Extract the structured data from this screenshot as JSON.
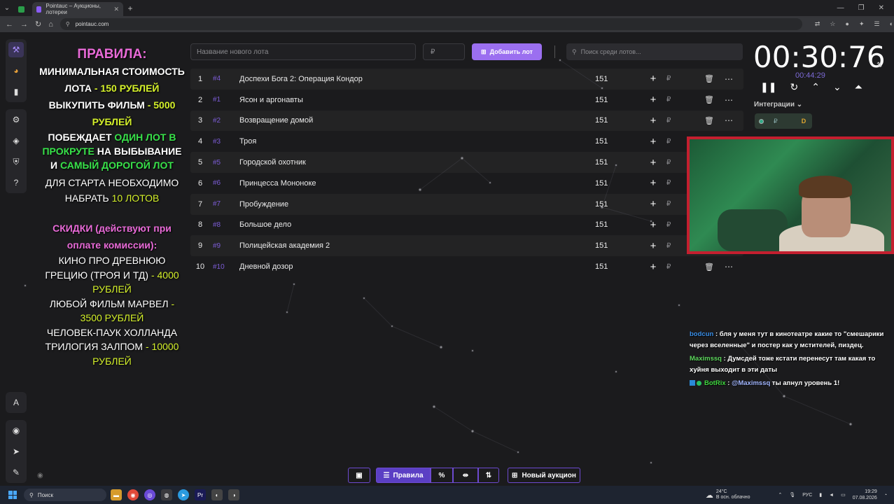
{
  "browser": {
    "tabs": [
      {
        "title": ""
      },
      {
        "title": "Pointauc – Аукционы, лотереи"
      }
    ],
    "url": "pointauc.com"
  },
  "rules": {
    "title": "ПРАВИЛА:",
    "min_price_label": "МИНИМАЛЬНАЯ СТОИМОСТЬ ЛОТА",
    "min_price_value": "- 150 РУБЛЕЙ",
    "buyout_label": "ВЫКУПИТЬ ФИЛЬМ",
    "buyout_value": "- 5000 РУБЛЕЙ",
    "wins_pre": "ПОБЕЖДАЕТ",
    "wins_g1": "ОДИН ЛОТ В ПРОКРУТЕ",
    "wins_mid": "НА ВЫБЫВАНИЕ И",
    "wins_g2": "САМЫЙ ДОРОГОЙ ЛОТ",
    "start_label": "ДЛЯ СТАРТА НЕОБХОДИМО НАБРАТЬ",
    "start_value": "10 ЛОТОВ",
    "discounts_title": "СКИДКИ (действуют при оплате комиссии):",
    "d1_label": "КИНО ПРО ДРЕВНЮЮ ГРЕЦИЮ (ТРОЯ И ТД)",
    "d1_value": "- 4000 РУБЛЕЙ",
    "d2_label": "ЛЮБОЙ ФИЛЬМ МАРВЕЛ",
    "d2_value": "- 3500 РУБЛЕЙ",
    "d3_label": "ЧЕЛОВЕК-ПАУК ХОЛЛАНДА ТРИЛОГИЯ ЗАЛПОМ",
    "d3_value": "- 10000 РУБЛЕЙ"
  },
  "form": {
    "name_placeholder": "Название нового лота",
    "price_placeholder": "₽",
    "add_label": "Добавить лот",
    "search_placeholder": "Поиск среди лотов..."
  },
  "lots": [
    {
      "n": "1",
      "id": "#4",
      "name": "Доспехи Бога 2: Операция Кондор",
      "amount": "151",
      "cur": "₽"
    },
    {
      "n": "2",
      "id": "#1",
      "name": "Ясон и аргонавты",
      "amount": "151",
      "cur": "₽"
    },
    {
      "n": "3",
      "id": "#2",
      "name": "Возвращение домой",
      "amount": "151",
      "cur": "₽"
    },
    {
      "n": "4",
      "id": "#3",
      "name": "Троя",
      "amount": "151",
      "cur": "₽"
    },
    {
      "n": "5",
      "id": "#5",
      "name": "Городской охотник",
      "amount": "151",
      "cur": "₽"
    },
    {
      "n": "6",
      "id": "#6",
      "name": "Принцесса Мононоке",
      "amount": "151",
      "cur": "₽"
    },
    {
      "n": "7",
      "id": "#7",
      "name": "Пробуждение",
      "amount": "151",
      "cur": "₽"
    },
    {
      "n": "8",
      "id": "#8",
      "name": "Большое дело",
      "amount": "151",
      "cur": "₽"
    },
    {
      "n": "9",
      "id": "#9",
      "name": "Полицейская академия 2",
      "amount": "151",
      "cur": "₽"
    },
    {
      "n": "10",
      "id": "#10",
      "name": "Дневной дозор",
      "amount": "151",
      "cur": "₽"
    }
  ],
  "timer": {
    "main": "00:30:76",
    "sub": "00:44:29"
  },
  "integrations": {
    "label": "Интеграции",
    "cur": "₽",
    "d": "D"
  },
  "chat": [
    {
      "user": "bodcun",
      "text": ": бля у меня тут в кинотеатре какие то \"смешарики через вселенные\" и постер как у мстителей, пиздец."
    },
    {
      "user": "Maximssq",
      "text": ": Думсдей тоже кстати перенесут там какая то хуйня выходит в эти даты"
    },
    {
      "user": "BotRix",
      "sep": ": ",
      "mention": "@Maximssq",
      "text": " ты апнул уровень 1!"
    }
  ],
  "bottom": {
    "rules_label": "Правила",
    "new_auction_label": "Новый аукцион"
  },
  "taskbar": {
    "search": "Поиск",
    "temp": "24°C",
    "weather": "В осн. облачно",
    "lang": "РУС",
    "time": "19:29",
    "date": "07.08.2026"
  },
  "colors": {
    "accent": "#9b6ff0",
    "rules_pink": "#e86ad7",
    "rules_yellow": "#d4f02a",
    "rules_green": "#38e24a",
    "webcam_border": "#c41f2f"
  }
}
